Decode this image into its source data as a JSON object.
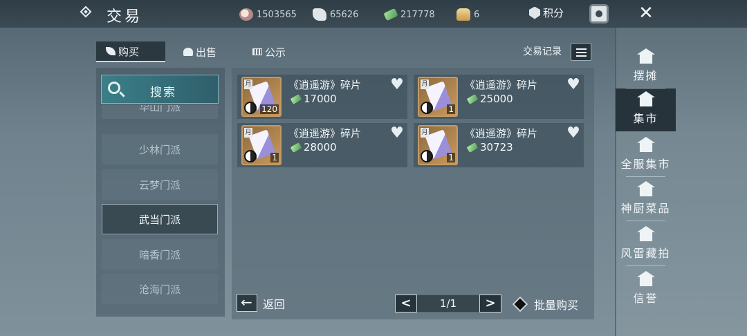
{
  "header": {
    "title": "交易",
    "currencies": [
      {
        "icon": "silver-coin-icon",
        "value": "1503565"
      },
      {
        "icon": "ingot-icon",
        "value": "65626"
      },
      {
        "icon": "jade-icon",
        "value": "217778"
      },
      {
        "icon": "gold-ingot-icon",
        "value": "6"
      }
    ],
    "points_label": "积分"
  },
  "tabs": [
    {
      "label": "购买",
      "active": true
    },
    {
      "label": "出售",
      "active": false
    },
    {
      "label": "公示",
      "active": false
    }
  ],
  "records_label": "交易记录",
  "search": {
    "label": "搜索"
  },
  "sects": [
    {
      "label": "华山门派",
      "state": "partial"
    },
    {
      "label": "少林门派",
      "state": "normal"
    },
    {
      "label": "云梦门派",
      "state": "normal"
    },
    {
      "label": "武当门派",
      "state": "active"
    },
    {
      "label": "暗香门派",
      "state": "normal"
    },
    {
      "label": "沧海门派",
      "state": "normal"
    }
  ],
  "items": [
    {
      "name": "《逍遥游》碎片",
      "price": "17000",
      "qty": "120",
      "tag": "月"
    },
    {
      "name": "《逍遥游》碎片",
      "price": "25000",
      "qty": "1",
      "tag": "月"
    },
    {
      "name": "《逍遥游》碎片",
      "price": "28000",
      "qty": "1",
      "tag": "月"
    },
    {
      "name": "《逍遥游》碎片",
      "price": "30723",
      "qty": "1",
      "tag": "月"
    }
  ],
  "footer": {
    "back_label": "返回",
    "page": "1/1",
    "prev": "<",
    "next": ">",
    "bulk_label": "批量购买"
  },
  "side_nav": [
    {
      "label": "摆摊",
      "active": false
    },
    {
      "label": "集市",
      "active": true
    },
    {
      "label": "全服集市",
      "active": false
    },
    {
      "label": "神厨菜品",
      "active": false
    },
    {
      "label": "风雷藏拍",
      "active": false
    },
    {
      "label": "信誉",
      "active": false
    }
  ],
  "colors": {
    "accent": "#3a7f88",
    "active_bg": "#26333b"
  }
}
